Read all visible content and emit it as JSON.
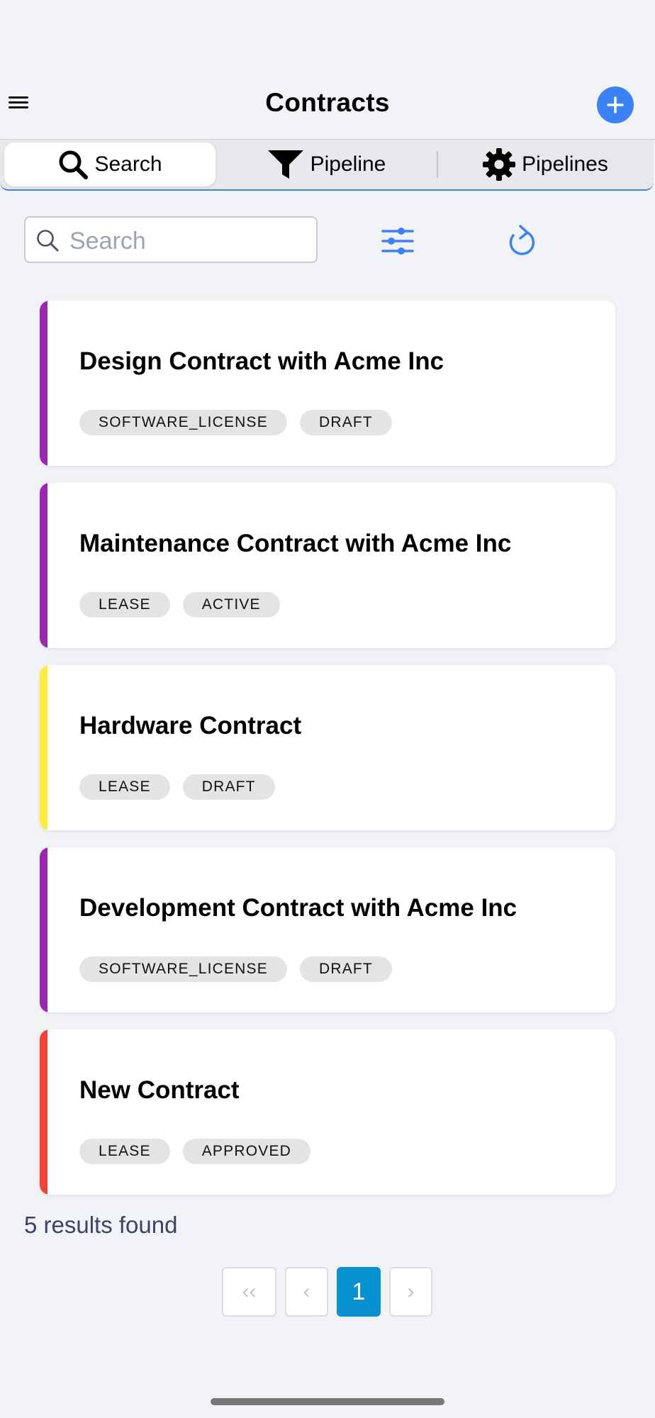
{
  "header": {
    "title": "Contracts"
  },
  "tabs": [
    {
      "label": "Search",
      "icon": "search-icon",
      "active": true
    },
    {
      "label": "Pipeline",
      "icon": "filter-funnel-icon",
      "active": false
    },
    {
      "label": "Pipelines",
      "icon": "gear-icon",
      "active": false
    }
  ],
  "search": {
    "placeholder": "Search",
    "value": ""
  },
  "contracts": [
    {
      "title": "Design Contract with Acme Inc",
      "tags": [
        "SOFTWARE_LICENSE",
        "DRAFT"
      ],
      "color": "#9c27b0"
    },
    {
      "title": "Maintenance Contract with Acme Inc",
      "tags": [
        "LEASE",
        "ACTIVE"
      ],
      "color": "#9c27b0"
    },
    {
      "title": "Hardware Contract",
      "tags": [
        "LEASE",
        "DRAFT"
      ],
      "color": "#ffeb3b"
    },
    {
      "title": "Development Contract with Acme Inc",
      "tags": [
        "SOFTWARE_LICENSE",
        "DRAFT"
      ],
      "color": "#9c27b0"
    },
    {
      "title": "New Contract",
      "tags": [
        "LEASE",
        "APPROVED"
      ],
      "color": "#f44336"
    }
  ],
  "results_text": "5 results found",
  "pagination": {
    "first": "‹‹",
    "prev": "‹",
    "current": "1",
    "next": "›"
  },
  "colors": {
    "accent": "#3b82f6",
    "page_active": "#0891d1"
  }
}
